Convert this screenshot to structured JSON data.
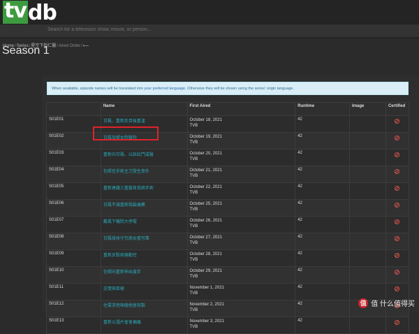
{
  "logo": {
    "tv": "tv",
    "db": "db"
  },
  "search": {
    "placeholder": "Search for a television show, movie, or person..."
  },
  "breadcrumb": {
    "home": "Home",
    "series": "Series",
    "show": "星空下的仁醫",
    "order": "Aired Order",
    "back": "⟵"
  },
  "page_title": "Season 1",
  "notice": {
    "before": "When available, episode names will be translated into ",
    "link": "your preferred language",
    "after": ". Otherwise they will be shown using the series' origin language."
  },
  "table": {
    "headers": {
      "code": "",
      "name": "Name",
      "aired": "First Aired",
      "runtime": "Runtime",
      "image": "Image",
      "certified": "Certified"
    },
    "rows": [
      {
        "code": "S01E01",
        "name": "甘鳳、重新反目後重逢",
        "date": "October 18, 2021",
        "network": "TVB",
        "runtime": "42"
      },
      {
        "code": "S01E02",
        "name": "甘鳳加盟女院醫院",
        "date": "October 19, 2021",
        "network": "TVB",
        "runtime": "42"
      },
      {
        "code": "S01E03",
        "name": "重新向甘鳳、以訴訟鬥或醫",
        "date": "October 20, 2021",
        "network": "TVB",
        "runtime": "42"
      },
      {
        "code": "S01E04",
        "name": "包照任手術主刀發生意外",
        "date": "October 21, 2021",
        "network": "TVB",
        "runtime": "42"
      },
      {
        "code": "S01E05",
        "name": "重新建議三重醫首長暗手術",
        "date": "October 22, 2021",
        "network": "TVB",
        "runtime": "42"
      },
      {
        "code": "S01E06",
        "name": "甘鳳不滿重新偽裝痛藥",
        "date": "October 25, 2021",
        "network": "TVB",
        "runtime": "42"
      },
      {
        "code": "S01E07",
        "name": "戴鳳下機院大停電",
        "date": "October 26, 2021",
        "network": "TVB",
        "runtime": "42"
      },
      {
        "code": "S01E08",
        "name": "甘鳳接收守究病女產可靠",
        "date": "October 27, 2021",
        "network": "TVB",
        "runtime": "42"
      },
      {
        "code": "S01E09",
        "name": "重新反駁病倫勸控",
        "date": "October 28, 2021",
        "network": "TVB",
        "runtime": "42"
      },
      {
        "code": "S01E10",
        "name": "包照向重新伸出援手",
        "date": "October 29, 2021",
        "network": "TVB",
        "runtime": "42"
      },
      {
        "code": "S01E11",
        "name": "芝懷與苗樹",
        "date": "November 1, 2021",
        "network": "TVB",
        "runtime": "42"
      },
      {
        "code": "S01E12",
        "name": "住雲求甩咪龍他居目製",
        "date": "November 2, 2021",
        "network": "TVB",
        "runtime": "42"
      },
      {
        "code": "S01E13",
        "name": "重新以潛片會會偏痛",
        "date": "November 3, 2021",
        "network": "TVB",
        "runtime": "42"
      }
    ]
  },
  "watermark": {
    "text": "值 什么值得买",
    "icon": "值"
  }
}
